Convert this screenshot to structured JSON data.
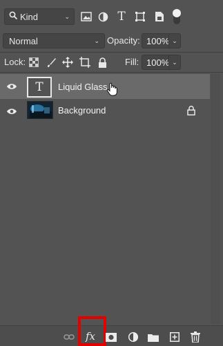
{
  "filter": {
    "kind_label": "Kind",
    "icons": [
      "search-icon",
      "image-filter-icon",
      "adjustment-filter-icon",
      "type-filter-icon",
      "shape-filter-icon",
      "smart-object-filter-icon"
    ]
  },
  "blend": {
    "mode": "Normal",
    "opacity_label": "Opacity:",
    "opacity_value": "100%"
  },
  "lock": {
    "label": "Lock:",
    "fill_label": "Fill:",
    "fill_value": "100%"
  },
  "layers": [
    {
      "name": "Liquid Glass",
      "type": "text",
      "thumb_glyph": "T",
      "selected": true,
      "visible": true
    },
    {
      "name": "Background",
      "type": "image",
      "selected": false,
      "visible": true,
      "locked": true
    }
  ],
  "bottom": {
    "fx_label": "fx",
    "highlight_color": "#e20000",
    "icons": [
      "link-icon",
      "fx-icon",
      "mask-icon",
      "adjustment-icon",
      "folder-icon",
      "new-layer-icon",
      "trash-icon"
    ]
  },
  "colors": {
    "panel_bg": "#535353",
    "selected_row": "#6a6a6a"
  }
}
